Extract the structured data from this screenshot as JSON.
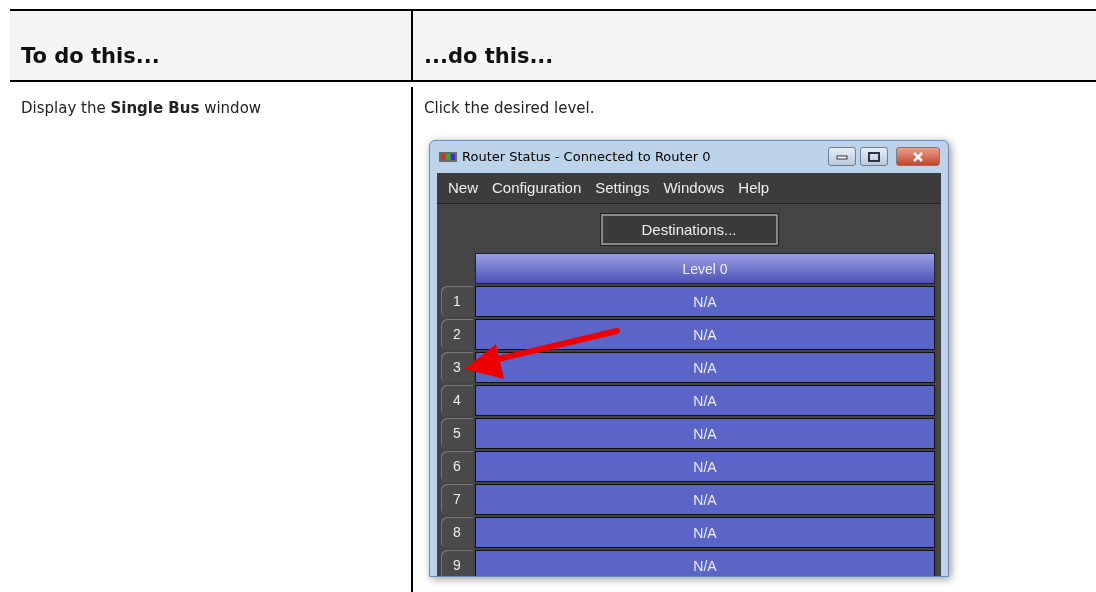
{
  "table": {
    "columns": [
      "To do this...",
      "...do this..."
    ],
    "rows": [
      {
        "task": "Display the **Single Bus** window",
        "action": "Click the desired level.",
        "screenshot": {
          "title": "Router Status - Connected to Router 0",
          "menu": [
            "New",
            "Configuration",
            "Settings",
            "Windows",
            "Help"
          ],
          "toolbar_button": "Destinations...",
          "level_header": "Level 0",
          "rows": [
            {
              "number": "1",
              "value": "N/A"
            },
            {
              "number": "2",
              "value": "N/A"
            },
            {
              "number": "3",
              "value": "N/A"
            },
            {
              "number": "4",
              "value": "N/A"
            },
            {
              "number": "5",
              "value": "N/A"
            },
            {
              "number": "6",
              "value": "N/A"
            },
            {
              "number": "7",
              "value": "N/A"
            },
            {
              "number": "8",
              "value": "N/A"
            },
            {
              "number": "9",
              "value": "N/A"
            }
          ]
        }
      }
    ]
  }
}
